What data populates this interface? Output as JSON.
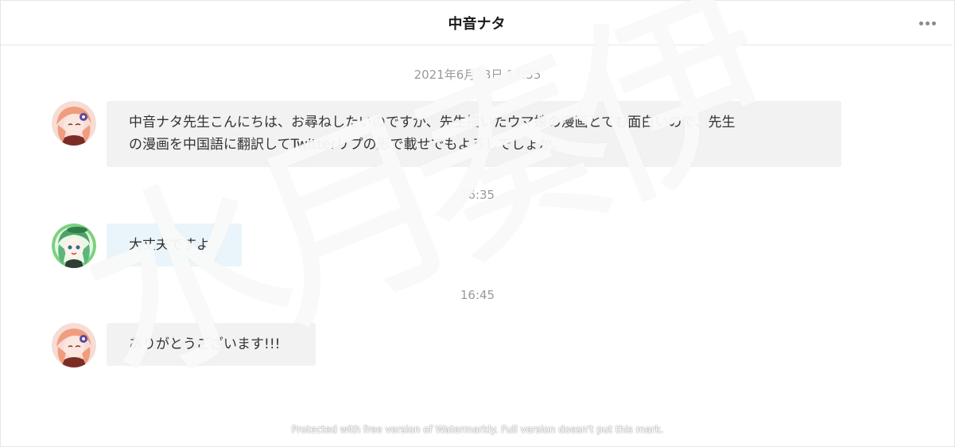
{
  "header": {
    "title": "中音ナタ",
    "more_icon": "more-dots-icon"
  },
  "messages": [
    {
      "timestamp": "2021年6月28日 14:55",
      "sender": "self",
      "text_line1": "中音ナタ先生こんにちは、お尋ねしたいのですが、先生描いたウマ娘の漫画とても面白いので、先生",
      "text_line2": "の漫画を中国語に翻訳してTwitterリプの形で載せでもよろしでしょか。"
    },
    {
      "timestamp": "16:35",
      "sender": "other",
      "text_line1": "大丈夫ですよ"
    },
    {
      "timestamp": "16:45",
      "sender": "self",
      "text_line1": "ありがとうございます!!!"
    }
  ],
  "watermark": {
    "glyphs": [
      "水",
      "月",
      "奏",
      "伊"
    ],
    "notice": "Protected with free version of Watermarkly. Full version doesn't put this mark."
  },
  "colors": {
    "self_bubble": "#f2f2f2",
    "other_bubble": "#eaf5fb",
    "timestamp": "#9a9a9a",
    "text": "#333333"
  }
}
